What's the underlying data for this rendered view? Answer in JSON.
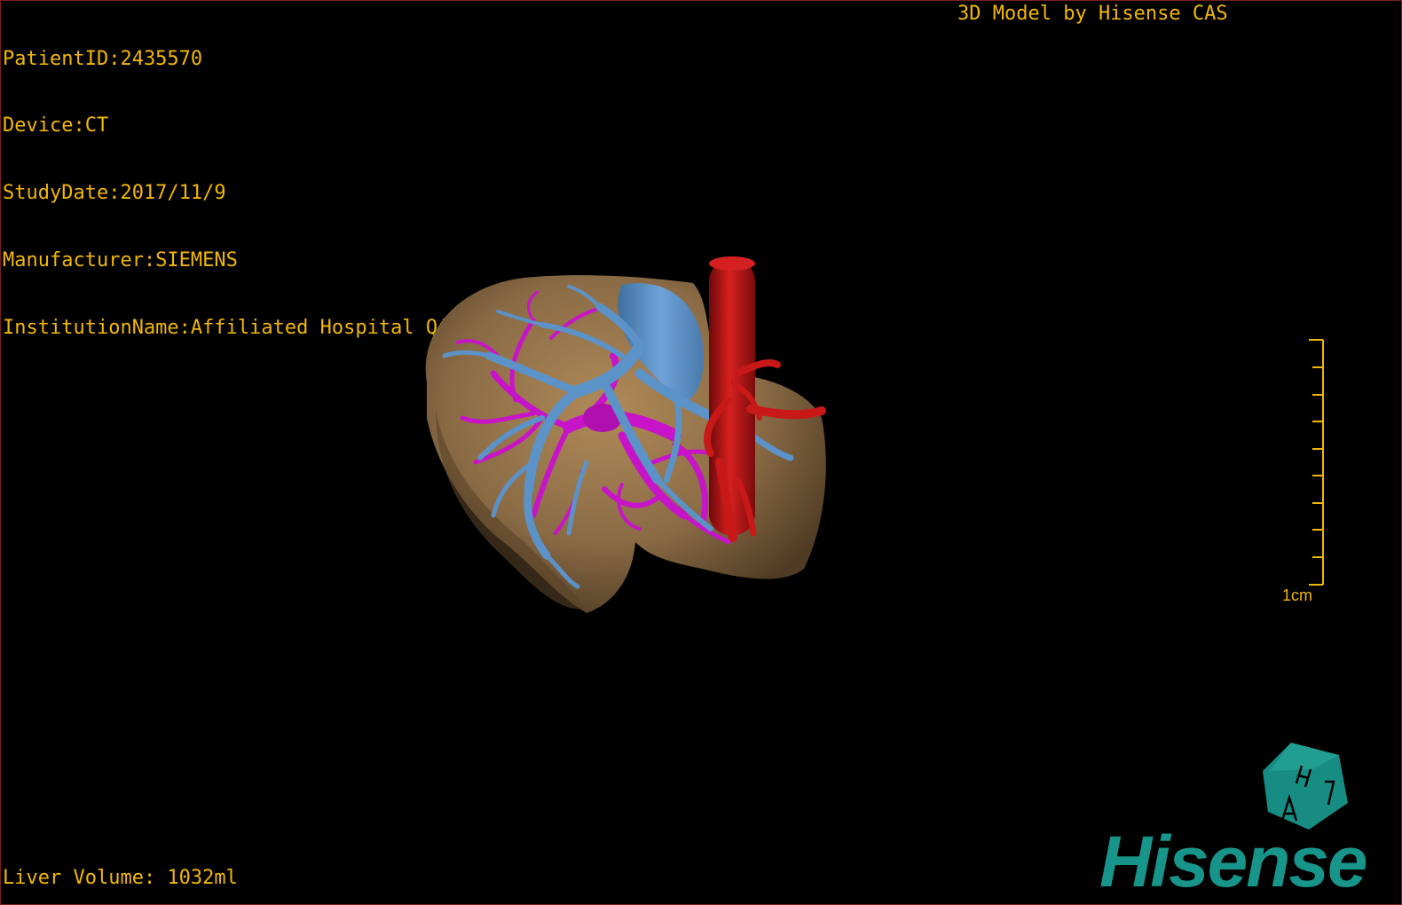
{
  "overlay": {
    "patient_id": "PatientID:2435570",
    "device": "Device:CT",
    "study_date": "StudyDate:2017/11/9",
    "manufacturer": "Manufacturer:SIEMENS",
    "institution": "InstitutionName:Affiliated Hospital Qingdao University-C",
    "credit": "3D Model by Hisense CAS",
    "liver_volume": "Liver Volume: 1032ml"
  },
  "scale_bar": {
    "label": "1cm"
  },
  "logo": {
    "cube_letters": [
      "H",
      "A"
    ],
    "brand": "Hisense"
  },
  "colors": {
    "overlay_text": "#f2b705",
    "liver": "#8a6b45",
    "portal_vein": "#5b92c8",
    "hepatic_vein": "#c814c8",
    "aorta": "#b31616",
    "brand": "#17958a",
    "frame": "#7a1f1f"
  }
}
